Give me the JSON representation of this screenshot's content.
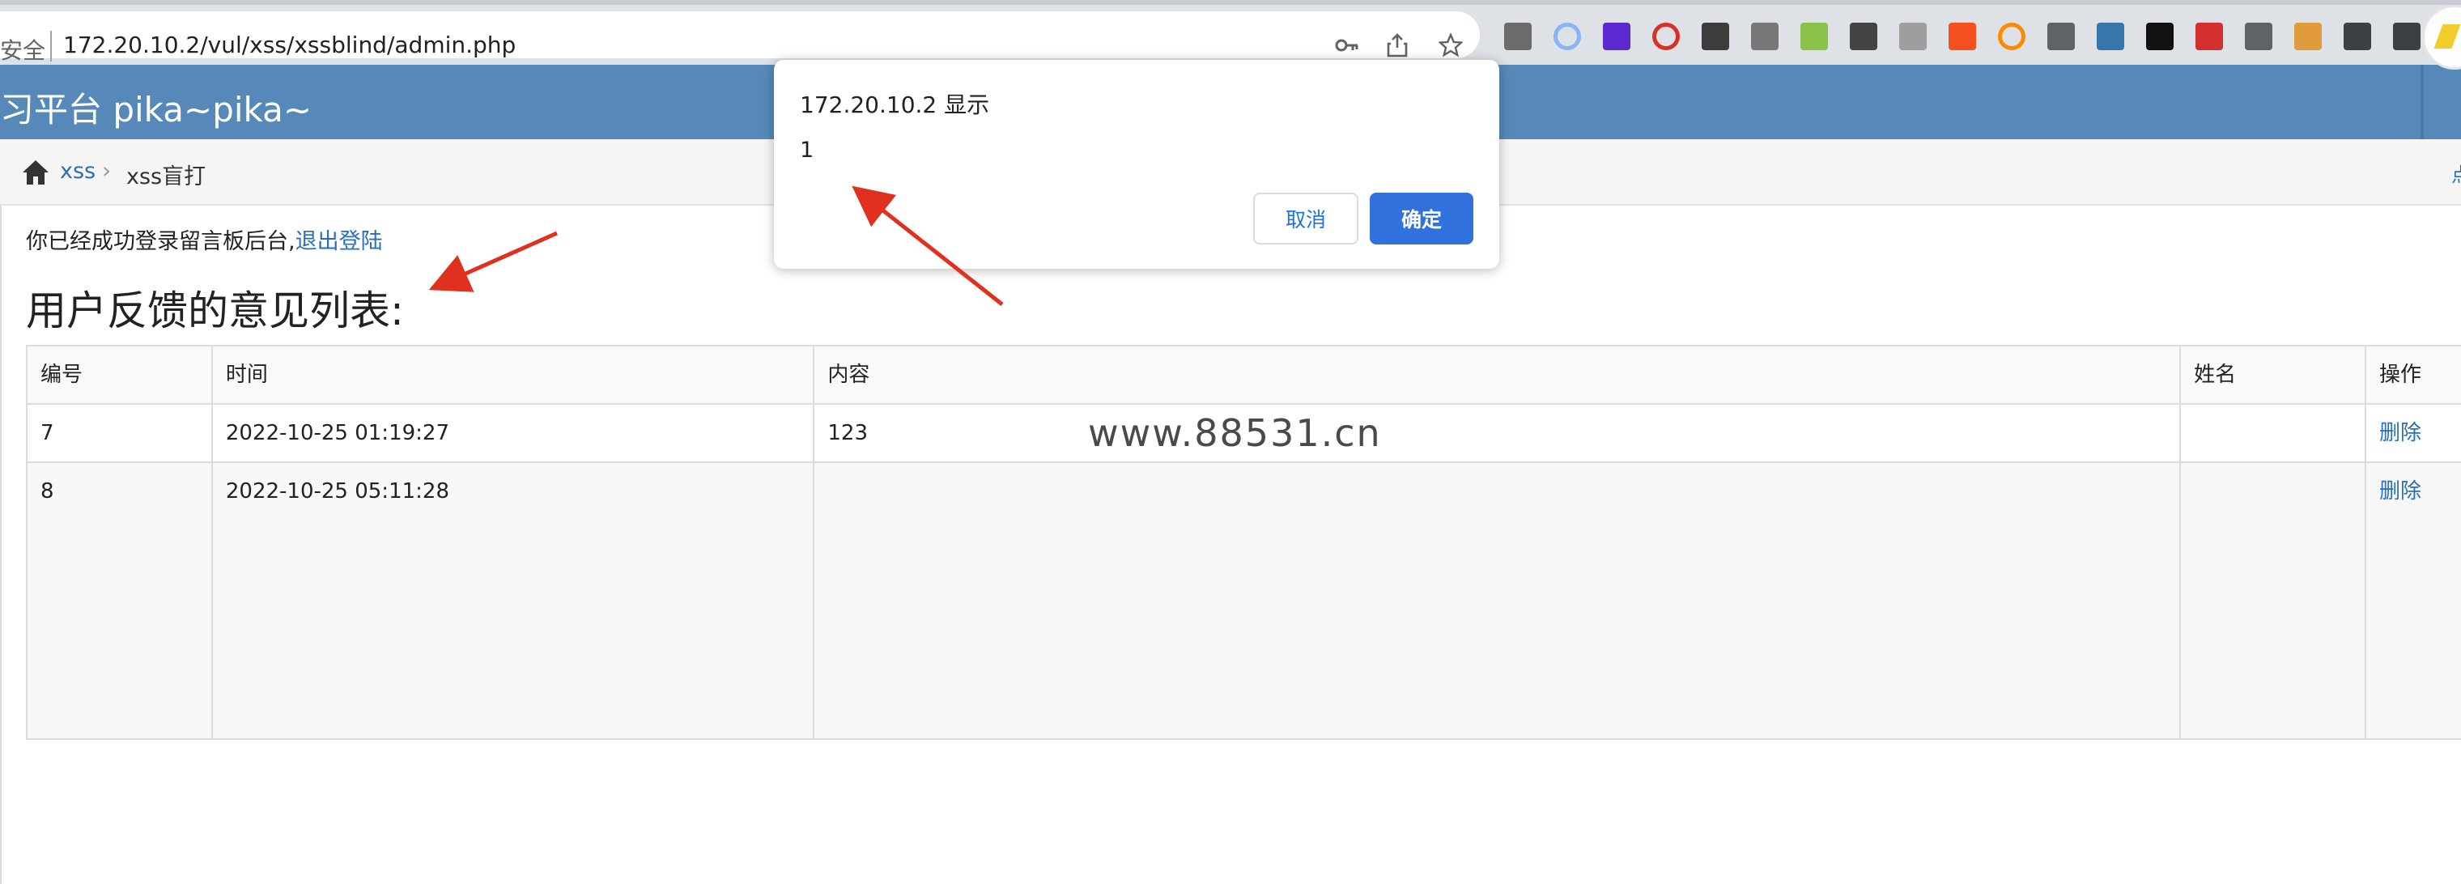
{
  "browser": {
    "security_label": "安全",
    "url": "172.20.10.2/vul/xss/xssblind/admin.php",
    "icons": [
      "key-icon",
      "share-icon",
      "star-icon"
    ],
    "extensions": [
      {
        "name": "download-extension-icon",
        "color": "#6b6b6b"
      },
      {
        "name": "circle-extension-icon",
        "color": "#8ab4f8"
      },
      {
        "name": "purple-extension-icon",
        "color": "#5b2bd1"
      },
      {
        "name": "red-ring-extension-icon",
        "color": "#d93025"
      },
      {
        "name": "glyph-extension-icon-1",
        "color": "#3c3c3c"
      },
      {
        "name": "glyph-extension-icon-2",
        "color": "#777777"
      },
      {
        "name": "glyph-extension-icon-3",
        "color": "#8bc34a"
      },
      {
        "name": "glyph-extension-icon-4",
        "color": "#444444"
      },
      {
        "name": "glyph-extension-icon-5",
        "color": "#9e9e9e"
      },
      {
        "name": "orange-extension-icon",
        "color": "#f4511e"
      },
      {
        "name": "orange-ring-extension-icon",
        "color": "#fb8c00"
      },
      {
        "name": "puzzle-extension-icon",
        "color": "#5f6368"
      },
      {
        "name": "python-extension-icon",
        "color": "#3776ab"
      },
      {
        "name": "ghost-extension-icon",
        "color": "#111111"
      },
      {
        "name": "red-bar-extension-icon",
        "color": "#d32f2f"
      },
      {
        "name": "badge-extension-icon",
        "color": "#5f6368"
      },
      {
        "name": "box-extension-icon",
        "color": "#e09b3d"
      },
      {
        "name": "puzzle-piece-icon",
        "color": "#3c4043"
      },
      {
        "name": "reading-list-icon",
        "color": "#3c4043"
      }
    ]
  },
  "header": {
    "title": "习平台 pika~pika~"
  },
  "breadcrumb": {
    "link": "xss",
    "separator": "›",
    "current": "xss盲打",
    "edge_text": "点"
  },
  "content": {
    "login_message": "你已经成功登录留言板后台,",
    "logout_link": "退出登陆",
    "title": "用户反馈的意见列表:"
  },
  "table": {
    "headers": [
      "编号",
      "时间",
      "内容",
      "姓名",
      "操作"
    ],
    "rows": [
      [
        "7",
        "2022-10-25 01:19:27",
        "123",
        "",
        "删除"
      ],
      [
        "8",
        "2022-10-25 05:11:28",
        "",
        "",
        "删除"
      ]
    ]
  },
  "watermark": "www.88531.cn",
  "dialog": {
    "title": "172.20.10.2 显示",
    "message": "1",
    "cancel_label": "取消",
    "ok_label": "确定"
  },
  "colors": {
    "header_bg": "#5689b9",
    "link": "#2a6fb5",
    "ok_button": "#3171de",
    "annotation_arrow": "#e0311f"
  }
}
